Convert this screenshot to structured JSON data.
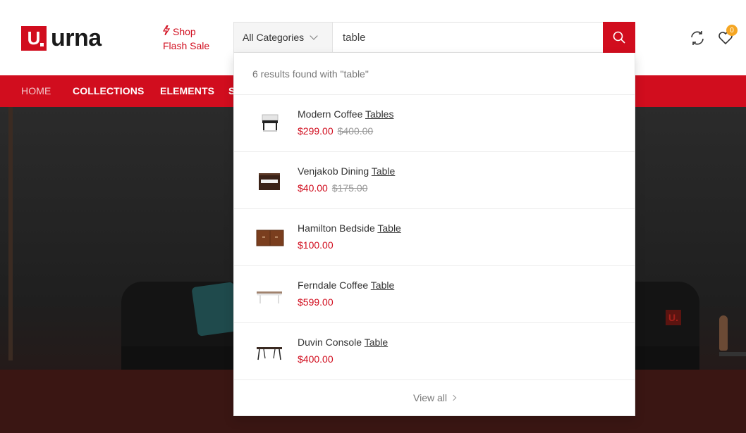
{
  "brand": {
    "logo_letter": "U",
    "name": "urna",
    "accent": "#d10d1e"
  },
  "flash": {
    "line1": "Shop",
    "line2": "Flash Sale"
  },
  "search": {
    "category": "All Categories",
    "query": "table",
    "results_summary": "6 results found with \"table\"",
    "view_all": "View all"
  },
  "header_icons": {
    "compare": "refresh-icon",
    "wishlist": "heart-icon",
    "wishlist_count": "0"
  },
  "nav": {
    "items": [
      "HOME",
      "COLLECTIONS",
      "ELEMENTS",
      "S"
    ]
  },
  "results": [
    {
      "name_prefix": "Modern Coffee ",
      "name_match": "Tables",
      "price": "$299.00",
      "old_price": "$400.00",
      "thumb": "white-side-table-icon"
    },
    {
      "name_prefix": "Venjakob Dining ",
      "name_match": "Table",
      "price": "$40.00",
      "old_price": "$175.00",
      "thumb": "dark-drawer-table-icon"
    },
    {
      "name_prefix": "Hamilton Bedside ",
      "name_match": "Table",
      "price": "$100.00",
      "old_price": "",
      "thumb": "wood-cabinet-icon"
    },
    {
      "name_prefix": "Ferndale Coffee ",
      "name_match": "Table",
      "price": "$599.00",
      "old_price": "",
      "thumb": "white-coffee-table-icon"
    },
    {
      "name_prefix": "Duvin Console ",
      "name_match": "Table",
      "price": "$400.00",
      "old_price": "",
      "thumb": "console-table-icon"
    }
  ],
  "hero": {
    "corner_mark": "U."
  }
}
